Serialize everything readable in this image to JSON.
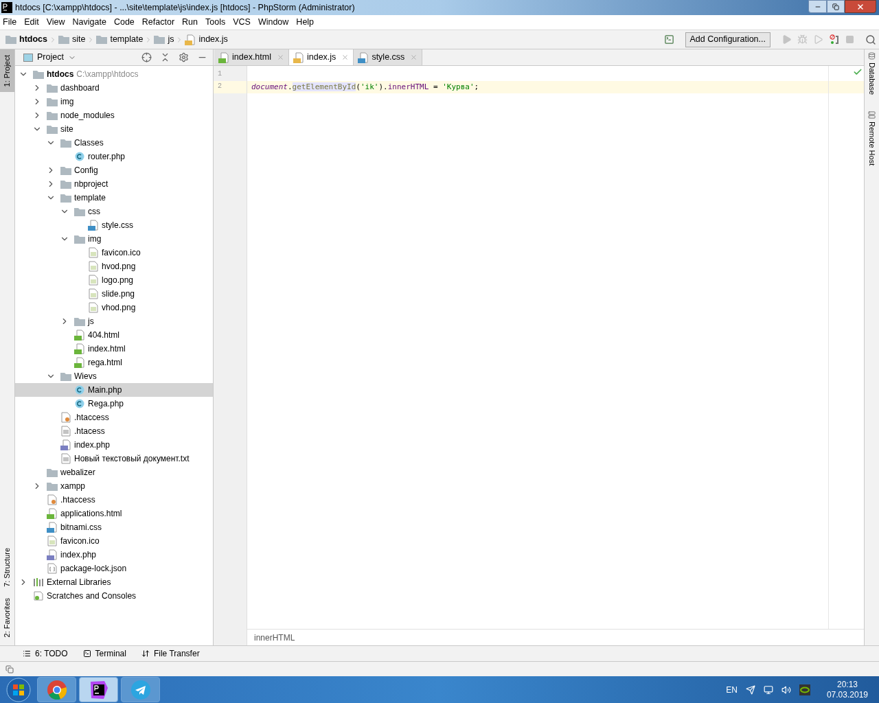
{
  "window": {
    "title": "htdocs [C:\\xampp\\htdocs] - ...\\site\\template\\js\\index.js [htdocs] - PhpStorm (Administrator)"
  },
  "menu": [
    "File",
    "Edit",
    "View",
    "Navigate",
    "Code",
    "Refactor",
    "Run",
    "Tools",
    "VCS",
    "Window",
    "Help"
  ],
  "breadcrumbs": [
    {
      "label": "htdocs",
      "kind": "root"
    },
    {
      "label": "site",
      "kind": "folder"
    },
    {
      "label": "template",
      "kind": "folder"
    },
    {
      "label": "js",
      "kind": "folder"
    },
    {
      "label": "index.js",
      "kind": "js"
    }
  ],
  "run_config": {
    "label": "Add Configuration..."
  },
  "left_stripe": [
    {
      "label": "1: Project",
      "selected": true
    },
    {
      "label": "7: Structure",
      "selected": false
    },
    {
      "label": "2: Favorites",
      "selected": false
    }
  ],
  "right_stripe": [
    {
      "label": "Database",
      "kind": "database"
    },
    {
      "label": "Remote Host",
      "kind": "remote"
    }
  ],
  "project_panel": {
    "title": "Project"
  },
  "tree": [
    {
      "label": "htdocs",
      "hint": "C:\\xampp\\htdocs",
      "kind": "folder",
      "expanded": true,
      "selected": false,
      "children": [
        {
          "label": "dashboard",
          "kind": "folder",
          "expanded": false,
          "selected": false
        },
        {
          "label": "img",
          "kind": "folder",
          "expanded": false,
          "selected": false
        },
        {
          "label": "node_modules",
          "kind": "folder",
          "expanded": false,
          "selected": false
        },
        {
          "label": "site",
          "kind": "folder",
          "expanded": true,
          "selected": false,
          "children": [
            {
              "label": "Classes",
              "kind": "folder",
              "expanded": true,
              "selected": false,
              "children": [
                {
                  "label": "router.php",
                  "kind": "class",
                  "selected": false
                }
              ]
            },
            {
              "label": "Config",
              "kind": "folder",
              "expanded": false,
              "selected": false
            },
            {
              "label": "nbproject",
              "kind": "folder",
              "expanded": false,
              "selected": false
            },
            {
              "label": "template",
              "kind": "folder",
              "expanded": true,
              "selected": false,
              "children": [
                {
                  "label": "css",
                  "kind": "folder",
                  "expanded": true,
                  "selected": false,
                  "children": [
                    {
                      "label": "style.css",
                      "kind": "css",
                      "selected": false
                    }
                  ]
                },
                {
                  "label": "img",
                  "kind": "folder",
                  "expanded": true,
                  "selected": false,
                  "children": [
                    {
                      "label": "favicon.ico",
                      "kind": "image",
                      "selected": false
                    },
                    {
                      "label": "hvod.png",
                      "kind": "image",
                      "selected": false
                    },
                    {
                      "label": "logo.png",
                      "kind": "image",
                      "selected": false
                    },
                    {
                      "label": "slide.png",
                      "kind": "image",
                      "selected": false
                    },
                    {
                      "label": "vhod.png",
                      "kind": "image",
                      "selected": false
                    }
                  ]
                },
                {
                  "label": "js",
                  "kind": "folder",
                  "expanded": false,
                  "selected": false
                },
                {
                  "label": "404.html",
                  "kind": "html",
                  "selected": false
                },
                {
                  "label": "index.html",
                  "kind": "html",
                  "selected": false
                },
                {
                  "label": "rega.html",
                  "kind": "html",
                  "selected": false
                }
              ]
            },
            {
              "label": "Wievs",
              "kind": "folder",
              "expanded": true,
              "selected": false,
              "children": [
                {
                  "label": "Main.php",
                  "kind": "class",
                  "selected": true
                },
                {
                  "label": "Rega.php",
                  "kind": "class",
                  "selected": false
                }
              ]
            },
            {
              "label": ".htaccess",
              "kind": "htaccess",
              "selected": false
            },
            {
              "label": ".htacess",
              "kind": "text",
              "selected": false
            },
            {
              "label": "index.php",
              "kind": "php",
              "selected": false
            },
            {
              "label": "Новый текстовый документ.txt",
              "kind": "text",
              "selected": false
            }
          ]
        },
        {
          "label": "webalizer",
          "kind": "empty-folder",
          "selected": false
        },
        {
          "label": "xampp",
          "kind": "folder",
          "expanded": false,
          "selected": false
        },
        {
          "label": ".htaccess",
          "kind": "htaccess",
          "selected": false
        },
        {
          "label": "applications.html",
          "kind": "html",
          "selected": false
        },
        {
          "label": "bitnami.css",
          "kind": "css",
          "selected": false
        },
        {
          "label": "favicon.ico",
          "kind": "image",
          "selected": false
        },
        {
          "label": "index.php",
          "kind": "php",
          "selected": false
        },
        {
          "label": "package-lock.json",
          "kind": "json",
          "selected": false
        }
      ]
    },
    {
      "label": "External Libraries",
      "kind": "library",
      "expanded": false,
      "selected": false
    },
    {
      "label": "Scratches and Consoles",
      "kind": "scratches",
      "selected": false
    }
  ],
  "tabs": [
    {
      "label": "index.html",
      "kind": "html",
      "selected": false
    },
    {
      "label": "index.js",
      "kind": "js",
      "selected": true
    },
    {
      "label": "style.css",
      "kind": "css",
      "selected": false
    }
  ],
  "editor": {
    "lines": [
      {
        "number": "1",
        "current": false
      },
      {
        "number": "2",
        "current": true,
        "tokens": [
          {
            "text": "document",
            "kind": "global"
          },
          {
            "text": ".",
            "kind": "plain"
          },
          {
            "text": "getElementById",
            "kind": "method"
          },
          {
            "text": "(",
            "kind": "plain"
          },
          {
            "text": "'ik'",
            "kind": "string"
          },
          {
            "text": ").",
            "kind": "plain"
          },
          {
            "text": "innerHTML",
            "kind": "field"
          },
          {
            "text": " = ",
            "kind": "plain"
          },
          {
            "text": "'Курва'",
            "kind": "string"
          },
          {
            "text": ";",
            "kind": "plain"
          }
        ]
      }
    ],
    "breadcrumb": "innerHTML"
  },
  "tool_windows": [
    {
      "label": "6: TODO",
      "kind": "todo"
    },
    {
      "label": "Terminal",
      "kind": "terminal"
    },
    {
      "label": "File Transfer",
      "kind": "transfer"
    }
  ],
  "taskbar": {
    "apps": [
      {
        "kind": "chrome",
        "selected": false
      },
      {
        "kind": "phpstorm",
        "selected": true
      },
      {
        "kind": "telegram",
        "selected": false
      }
    ],
    "language": "EN",
    "time": "20:13",
    "date": "07.03.2019"
  }
}
